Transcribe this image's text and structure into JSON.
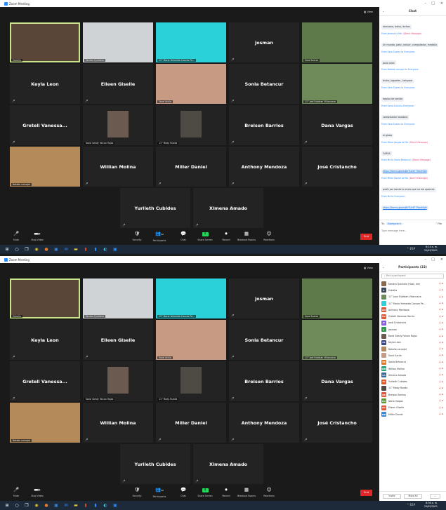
{
  "window": {
    "title": "Zoom Meeting",
    "view_label": "View"
  },
  "tiles": [
    {
      "name": "",
      "label": "Estrella",
      "speaking": true,
      "type": "video",
      "bg": "#5a4638"
    },
    {
      "name": "",
      "label": "Kendra Quintero",
      "type": "video",
      "bg": "#cfd3d6"
    },
    {
      "name": "",
      "label": "11° Maria Yeimeida Conzez Pe...",
      "type": "video",
      "bg": "#2ad1d8"
    },
    {
      "name": "josman",
      "label": "",
      "type": "name"
    },
    {
      "name": "",
      "label": "Sara Suarez",
      "type": "video",
      "bg": "#5f7a4a"
    },
    {
      "name": "Keyla Leon",
      "label": "",
      "type": "name"
    },
    {
      "name": "Eileen Giselle",
      "label": "",
      "type": "name"
    },
    {
      "name": "",
      "label": "Sarai Arcila",
      "type": "video",
      "bg": "#c79a84"
    },
    {
      "name": "Sonia Betancur",
      "label": "",
      "type": "name"
    },
    {
      "name": "",
      "label": "11° Joel Esteban Villanueva",
      "type": "video",
      "bg": "#6f8b5a"
    },
    {
      "name": "Gretell Vanessa...",
      "label": "",
      "type": "name"
    },
    {
      "name": "",
      "label": "Karol Sleidy Falcon Rojas",
      "type": "photo",
      "bg": "#6b5a50"
    },
    {
      "name": "",
      "label": "11° Mady Rueda",
      "type": "photo",
      "bg": "#4e4a44"
    },
    {
      "name": "Breison Barrios",
      "label": "",
      "type": "name"
    },
    {
      "name": "Dana Vargas",
      "label": "",
      "type": "name"
    },
    {
      "name": "",
      "label": "Natalia carvajal",
      "type": "video",
      "bg": "#b48a5a"
    },
    {
      "name": "Willian Molina",
      "label": "",
      "type": "name"
    },
    {
      "name": "Miller Daniel",
      "label": "",
      "type": "name"
    },
    {
      "name": "Anthony Mendoza",
      "label": "",
      "type": "name"
    },
    {
      "name": "José Cristancho",
      "label": "",
      "type": "name"
    },
    {
      "name": "Yurileth Cubides",
      "label": "",
      "type": "name"
    },
    {
      "name": "Ximena Amado",
      "label": "",
      "type": "name"
    }
  ],
  "toolbar": {
    "mute": "Mute",
    "video": "Stop Video",
    "security": "Security",
    "participants": "Participants",
    "participants_count": "22",
    "chat": "Chat",
    "share": "Share Screen",
    "record": "Record",
    "breakout": "Breakout Rooms",
    "reactions": "Reactions",
    "end": "End"
  },
  "taskbar": {
    "time_top": "8:14 a. m.",
    "time_bottom": "8:36 a. m.",
    "date": "25/05/2021",
    "lang": "ESP"
  },
  "chat": {
    "header": "Chat",
    "messages": [
      {
        "from": "",
        "private": "",
        "text": "manzana, bolso, lechos"
      },
      {
        "from": "From Jimena to Me:",
        "private": "(Direct Message)",
        "text": "Un mundo, pato, celular, computador, medalla"
      },
      {
        "from": "From Sara Suarez to Everyone:",
        "private": "",
        "text": "jaula aves"
      },
      {
        "from": "From Natalia carvajal to Everyone:",
        "private": "",
        "text": "leche, juguetes , lampara"
      },
      {
        "from": "From Sara Suarez to Everyone:",
        "private": "",
        "text": "equipo de sonido"
      },
      {
        "from": "From Sarai Arcila to Everyone:",
        "private": "",
        "text": "computador lavadora"
      },
      {
        "from": "From Sara Suarez to Everyone:",
        "private": "",
        "text": "el globo"
      },
      {
        "from": "From Dana Vargas to Me:",
        "private": "(Direct Message)",
        "text": "GAFAS"
      },
      {
        "from": "From Me to Sonia Betancur:",
        "private": "(Direct Message)",
        "text": "https://forms.gle/eqBrTUs977HavMiz6",
        "link": true
      },
      {
        "from": "From Miller Daniel to Me:",
        "private": "(Direct Message)",
        "text": "profe por donde lo envio que no me aparece"
      },
      {
        "from": "From Me to Everyone:",
        "private": "",
        "text": "https://forms.gle/eqBrTUs977HavMiz6",
        "link": true
      }
    ],
    "to_label": "To:",
    "to_value": "Everyone",
    "file_label": "File",
    "placeholder": "Type message here..."
  },
  "participants": {
    "header": "Participants (22)",
    "search_placeholder": "Find a participant",
    "list": [
      {
        "name": "Kendra Quintero (Host, me)",
        "initials": "",
        "color": "#8a6a4a"
      },
      {
        "name": "Estrella",
        "initials": "E",
        "color": "#3b4a5a"
      },
      {
        "name": "11° Juan Esteban Villanueva",
        "initials": "",
        "color": "#6f8b5a"
      },
      {
        "name": "11° Maria Yeimeida Conzez Pe...",
        "initials": "",
        "color": "#2ad1d8"
      },
      {
        "name": "Anthony Mendoza",
        "initials": "AM",
        "color": "#e0593a"
      },
      {
        "name": "Gretell Vanessa Garcia",
        "initials": "GV",
        "color": "#e0593a"
      },
      {
        "name": "José Cristancho",
        "initials": "JC",
        "color": "#8a5ad8"
      },
      {
        "name": "josman",
        "initials": "J",
        "color": "#2e9c4a"
      },
      {
        "name": "Karol Sleidy Falcon Rojas",
        "initials": "",
        "color": "#6b5a50"
      },
      {
        "name": "Keyla Leon",
        "initials": "KL",
        "color": "#3a4a8a"
      },
      {
        "name": "Natalia carvajal",
        "initials": "",
        "color": "#b48a5a"
      },
      {
        "name": "Sarai Arcila",
        "initials": "",
        "color": "#c79a84"
      },
      {
        "name": "Sonia Betancur",
        "initials": "SB",
        "color": "#e07a2a"
      },
      {
        "name": "Willian Molina",
        "initials": "WM",
        "color": "#2aa87a"
      },
      {
        "name": "Ximena Amado",
        "initials": "XA",
        "color": "#3a6a9a"
      },
      {
        "name": "Yurileth Cubides",
        "initials": "YC",
        "color": "#e05a2a"
      },
      {
        "name": "11° Mady Rueda",
        "initials": "",
        "color": "#4e4a44"
      },
      {
        "name": "Breison Barrios",
        "initials": "BB",
        "color": "#e0593a"
      },
      {
        "name": "Dana Vargas",
        "initials": "DV",
        "color": "#5a9a3a"
      },
      {
        "name": "Eileen Giselle",
        "initials": "EG",
        "color": "#e0593a"
      },
      {
        "name": "Miller Daniel",
        "initials": "MD",
        "color": "#3a8ad8"
      }
    ],
    "invite": "Invite",
    "mute_all": "Mute All",
    "more": "..."
  }
}
